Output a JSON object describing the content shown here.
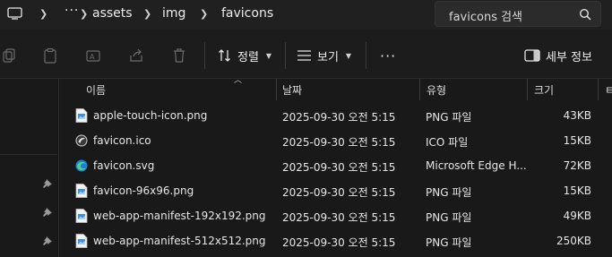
{
  "breadcrumb": {
    "pc_icon": "monitor-icon",
    "overflow": "···",
    "items": [
      "assets",
      "img",
      "favicons"
    ]
  },
  "search": {
    "placeholder": "favicons 검색",
    "icon": "search-icon"
  },
  "toolbar": {
    "icons": [
      "copy-icon",
      "paste-icon",
      "rename-icon",
      "share-icon",
      "delete-icon"
    ],
    "sort_label": "정렬",
    "view_label": "보기",
    "more_label": "···",
    "details_label": "세부 정보"
  },
  "columns": {
    "name": "이름",
    "date": "날짜",
    "type": "유형",
    "size": "크기",
    "extra": "ㅌ"
  },
  "files": [
    {
      "name": "apple-touch-icon.png",
      "date": "2025-09-30 오전 5:15",
      "type": "PNG 파일",
      "size": "43KB",
      "icon": "png-file-icon"
    },
    {
      "name": "favicon.ico",
      "date": "2025-09-30 오전 5:15",
      "type": "ICO 파일",
      "size": "15KB",
      "icon": "ico-file-icon"
    },
    {
      "name": "favicon.svg",
      "date": "2025-09-30 오전 5:15",
      "type": "Microsoft Edge H...",
      "size": "72KB",
      "icon": "edge-icon"
    },
    {
      "name": "favicon-96x96.png",
      "date": "2025-09-30 오전 5:15",
      "type": "PNG 파일",
      "size": "15KB",
      "icon": "png-file-icon"
    },
    {
      "name": "web-app-manifest-192x192.png",
      "date": "2025-09-30 오전 5:15",
      "type": "PNG 파일",
      "size": "49KB",
      "icon": "png-file-icon"
    },
    {
      "name": "web-app-manifest-512x512.png",
      "date": "2025-09-30 오전 5:15",
      "type": "PNG 파일",
      "size": "250KB",
      "icon": "png-file-icon"
    }
  ],
  "colors": {
    "background": "#191919",
    "accent": "#4aa3ff"
  }
}
